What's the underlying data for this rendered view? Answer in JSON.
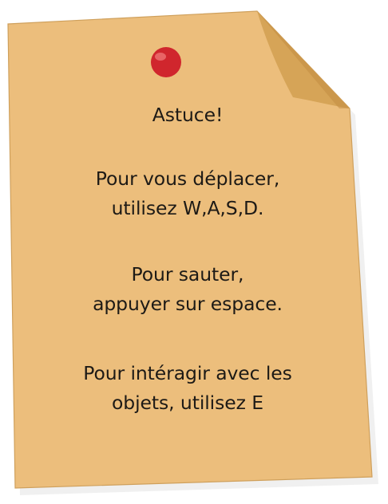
{
  "note": {
    "title": "Astuce!",
    "tips": [
      {
        "lines": [
          "Pour vous déplacer,",
          "utilisez W,A,S,D."
        ]
      },
      {
        "lines": [
          "Pour sauter,",
          "appuyer sur espace."
        ]
      },
      {
        "lines": [
          "Pour intéragir avec les",
          "objets, utilisez E"
        ]
      }
    ]
  },
  "colors": {
    "paper": "#ecbe7c",
    "paper_edge": "#cfa05c",
    "fold": "#d6a457",
    "fold_shadow": "#c08a40",
    "pin": "#d0262d",
    "pin_highlight": "#f07a78",
    "text": "#1d1a16"
  }
}
